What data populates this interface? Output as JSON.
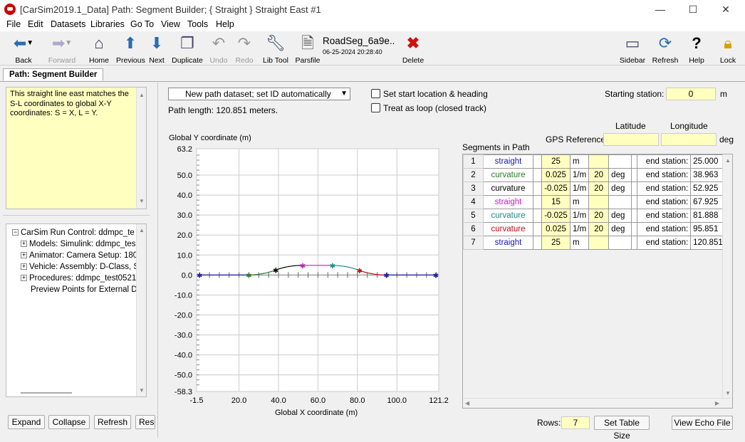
{
  "window": {
    "title": "[CarSim2019.1_Data] Path: Segment Builder; { Straight } Straight East #1",
    "controls": [
      "—",
      "☐",
      "✕"
    ]
  },
  "menu": [
    "File",
    "Edit",
    "Datasets",
    "Libraries",
    "Go To",
    "View",
    "Tools",
    "Help"
  ],
  "toolbar": {
    "back": "Back",
    "forward": "Forward",
    "home": "Home",
    "previous": "Previous",
    "next": "Next",
    "duplicate": "Duplicate",
    "undo": "Undo",
    "redo": "Redo",
    "lib_tool": "Lib Tool",
    "parsfile": "Parsfile",
    "dataset_name": "RoadSeg_6a9e..",
    "dataset_date": "06-25-2024 20:28:40",
    "delete": "Delete",
    "sidebar": "Sidebar",
    "refresh": "Refresh",
    "help": "Help",
    "lock": "Lock"
  },
  "tab": "Path: Segment Builder",
  "notes": "This straight line east matches the S-L coordinates to global X-Y coordinates: S = X, L = Y.",
  "tree": {
    "root": "CarSim Run Control: ddmpc_te",
    "items": [
      "Models: Simulink: ddmpc_tes",
      "Animator: Camera Setup: 180",
      "Vehicle: Assembly: D-Class, S",
      "Procedures: ddmpc_test0521",
      "Preview Points for External D"
    ]
  },
  "bottom_buttons": {
    "expand": "Expand",
    "collapse": "Collapse",
    "refresh": "Refresh",
    "reset": "Rese"
  },
  "form": {
    "dataset_dropdown": "New path dataset; set ID automatically",
    "set_start": "Set start location & heading",
    "treat_loop": "Treat as loop (closed track)",
    "starting_station_label": "Starting station:",
    "starting_station_value": "0",
    "starting_station_unit": "m",
    "path_length": "Path length: 120.851 meters.",
    "latitude": "Latitude",
    "longitude": "Longitude",
    "gps_label": "GPS References",
    "gps_unit": "deg",
    "segments_label": "Segments in Path",
    "rows_label": "Rows:",
    "rows_value": "7",
    "set_table_size": "Set Table Size",
    "view_echo": "View Echo File"
  },
  "segments": [
    {
      "n": "1",
      "type": "straight",
      "color": "#1a1aa6",
      "value": "25",
      "unit": "m",
      "angle": "",
      "angle_unit": "",
      "end_label": "end station:",
      "end": "25.000"
    },
    {
      "n": "2",
      "type": "curvature",
      "color": "#2a7a2a",
      "value": "0.025",
      "unit": "1/m",
      "angle": "20",
      "angle_unit": "deg",
      "end_label": "end station:",
      "end": "38.963"
    },
    {
      "n": "3",
      "type": "curvature",
      "color": "#000000",
      "value": "-0.025",
      "unit": "1/m",
      "angle": "20",
      "angle_unit": "deg",
      "end_label": "end station:",
      "end": "52.925"
    },
    {
      "n": "4",
      "type": "straight",
      "color": "#c020c0",
      "value": "15",
      "unit": "m",
      "angle": "",
      "angle_unit": "",
      "end_label": "end station:",
      "end": "67.925"
    },
    {
      "n": "5",
      "type": "curvature",
      "color": "#1a8a8a",
      "value": "-0.025",
      "unit": "1/m",
      "angle": "20",
      "angle_unit": "deg",
      "end_label": "end station:",
      "end": "81.888"
    },
    {
      "n": "6",
      "type": "curvature",
      "color": "#c01010",
      "value": "0.025",
      "unit": "1/m",
      "angle": "20",
      "angle_unit": "deg",
      "end_label": "end station:",
      "end": "95.851"
    },
    {
      "n": "7",
      "type": "straight",
      "color": "#1a1aa6",
      "value": "25",
      "unit": "m",
      "angle": "",
      "angle_unit": "",
      "end_label": "end station:",
      "end": "120.851"
    }
  ],
  "plot": {
    "ylabel": "Global Y coordinate (m)",
    "xlabel": "Global X coordinate (m)",
    "xticks": [
      "-1.5",
      "20.0",
      "40.0",
      "60.0",
      "80.0",
      "100.0",
      "121.2"
    ],
    "yticks": [
      "63.2",
      "50.0",
      "40.0",
      "30.0",
      "20.0",
      "10.0",
      "0.0",
      "-10.0",
      "-20.0",
      "-30.0",
      "-40.0",
      "-50.0",
      "-58.3"
    ]
  }
}
